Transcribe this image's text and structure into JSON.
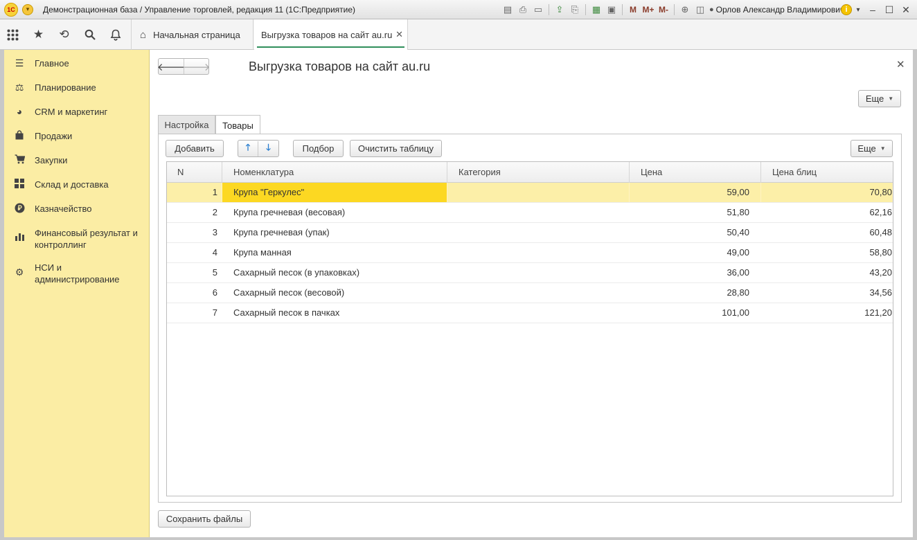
{
  "window": {
    "logo": "1С",
    "title": "Демонстрационная база / Управление торговлей, редакция 11  (1С:Предприятие)",
    "toolbar_marks": [
      "M",
      "M+",
      "M-"
    ],
    "user": "Орлов Александр Владимирович"
  },
  "tabs": {
    "home": "Начальная страница",
    "document": "Выгрузка товаров на сайт au.ru"
  },
  "sidebar": {
    "items": [
      {
        "label": "Главное",
        "icon": "menu-lines-icon"
      },
      {
        "label": "Планирование",
        "icon": "planning-icon"
      },
      {
        "label": "CRM и маркетинг",
        "icon": "pie-chart-icon"
      },
      {
        "label": "Продажи",
        "icon": "shopping-bag-icon"
      },
      {
        "label": "Закупки",
        "icon": "cart-icon"
      },
      {
        "label": "Склад и доставка",
        "icon": "warehouse-grid-icon"
      },
      {
        "label": "Казначейство",
        "icon": "ruble-coin-icon"
      },
      {
        "label": "Финансовый результат и контроллинг",
        "icon": "bar-chart-icon"
      },
      {
        "label": "НСИ и администрирование",
        "icon": "gear-icon"
      }
    ]
  },
  "form": {
    "title": "Выгрузка товаров на сайт au.ru",
    "more_label": "Еще",
    "tabs": [
      "Настройка",
      "Товары"
    ],
    "active_tab": "Товары",
    "table_toolbar": {
      "add": "Добавить",
      "pick": "Подбор",
      "clear": "Очистить таблицу",
      "more": "Еще"
    },
    "save_button": "Сохранить файлы"
  },
  "table": {
    "columns": [
      "N",
      "Номенклатура",
      "Категория",
      "Цена",
      "Цена блиц"
    ],
    "rows": [
      {
        "n": "1",
        "name": "Крупа \"Геркулес\"",
        "category": "",
        "price": "59,00",
        "blitz": "70,80"
      },
      {
        "n": "2",
        "name": "Крупа гречневая (весовая)",
        "category": "",
        "price": "51,80",
        "blitz": "62,16"
      },
      {
        "n": "3",
        "name": "Крупа гречневая (упак)",
        "category": "",
        "price": "50,40",
        "blitz": "60,48"
      },
      {
        "n": "4",
        "name": "Крупа манная",
        "category": "",
        "price": "49,00",
        "blitz": "58,80"
      },
      {
        "n": "5",
        "name": "Сахарный песок (в упаковках)",
        "category": "",
        "price": "36,00",
        "blitz": "43,20"
      },
      {
        "n": "6",
        "name": "Сахарный песок (весовой)",
        "category": "",
        "price": "28,80",
        "blitz": "34,56"
      },
      {
        "n": "7",
        "name": "Сахарный песок в пачках",
        "category": "",
        "price": "101,00",
        "blitz": "121,20"
      }
    ],
    "selected_row": 0
  },
  "colors": {
    "sidebar_bg": "#fbeda4",
    "selected_row": "#fcefa8",
    "focused_cell": "#fcd822",
    "active_tab_underline": "#2f8f5b"
  }
}
